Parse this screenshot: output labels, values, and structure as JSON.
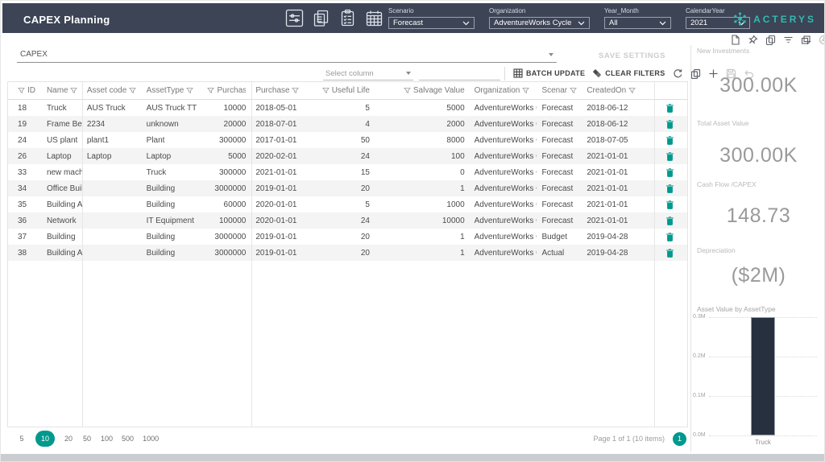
{
  "header": {
    "title": "CAPEX Planning",
    "toolbar_icons": [
      "sliders-icon",
      "copy-pages-icon",
      "checklist-icon",
      "calendar-icon"
    ],
    "filters": [
      {
        "label": "Scenario",
        "value": "Forecast"
      },
      {
        "label": "Organization",
        "value": "AdventureWorks Cycle"
      },
      {
        "label": "Year_Month",
        "value": "All"
      },
      {
        "label": "CalendarYear",
        "value": "2021"
      }
    ],
    "brand": "ACTERYS"
  },
  "visual_header_icons": [
    "new-page-icon",
    "pin-icon",
    "copy-icon",
    "filter-lines-icon",
    "layers-icon",
    "info-icon"
  ],
  "toolbar": {
    "table_select": "CAPEX",
    "save_settings": "SAVE SETTINGS",
    "select_column_placeholder": "Select column",
    "batch_update": "BATCH UPDATE",
    "clear_filters": "CLEAR FILTERS"
  },
  "table": {
    "columns": [
      "ID",
      "Name",
      "Asset code",
      "AssetType",
      "Purchase Value",
      "Purchase Date",
      "Useful Life",
      "Salvage Value",
      "Organization",
      "Scenario",
      "CreatedOn"
    ],
    "rows": [
      [
        "18",
        "Truck",
        "AUS Truck",
        "AUS Truck TT",
        "10000",
        "2018-05-01",
        "5",
        "5000",
        "AdventureWorks C...",
        "Forecast",
        "2018-06-12"
      ],
      [
        "19",
        "Frame Bend...",
        "2234",
        "unknown",
        "20000",
        "2018-07-01",
        "4",
        "2000",
        "AdventureWorks C...",
        "Forecast",
        "2018-06-12"
      ],
      [
        "24",
        "US plant",
        "plant1",
        "Plant",
        "300000",
        "2017-01-01",
        "50",
        "8000",
        "AdventureWorks C...",
        "Forecast",
        "2018-07-05"
      ],
      [
        "26",
        "Laptop",
        "Laptop",
        "Laptop",
        "5000",
        "2020-02-01",
        "24",
        "100",
        "AdventureWorks C...",
        "Forecast",
        "2021-01-01"
      ],
      [
        "33",
        "new machine",
        "",
        "Truck",
        "300000",
        "2021-01-01",
        "15",
        "0",
        "AdventureWorks C...",
        "Forecast",
        "2021-01-01"
      ],
      [
        "34",
        "Office Buildi...",
        "",
        "Building",
        "3000000",
        "2019-01-01",
        "20",
        "1",
        "AdventureWorks C...",
        "Forecast",
        "2021-01-01"
      ],
      [
        "35",
        "Building A",
        "",
        "Building",
        "60000",
        "2020-01-01",
        "5",
        "1000",
        "AdventureWorks C...",
        "Forecast",
        "2021-01-01"
      ],
      [
        "36",
        "Network",
        "",
        "IT Equipment",
        "100000",
        "2020-01-01",
        "24",
        "10000",
        "AdventureWorks C...",
        "Forecast",
        "2021-01-01"
      ],
      [
        "37",
        "Building",
        "",
        "Building",
        "3000000",
        "2019-01-01",
        "20",
        "1",
        "AdventureWorks C...",
        "Budget",
        "2019-04-28"
      ],
      [
        "38",
        "Building Act...",
        "",
        "Building",
        "3000000",
        "2019-01-01",
        "20",
        "1",
        "AdventureWorks C...",
        "Actual",
        "2019-04-28"
      ]
    ]
  },
  "pagination": {
    "page_sizes": [
      "5",
      "10",
      "20",
      "50",
      "100",
      "500",
      "1000"
    ],
    "selected_size": "10",
    "info": "Page 1 of 1 (10 items)",
    "current_page": "1"
  },
  "sidebar": {
    "kpis": [
      {
        "label": "New Investments",
        "value": "300.00K"
      },
      {
        "label": "Total Asset Value",
        "value": "300.00K"
      },
      {
        "label": "Cash Flow /CAPEX",
        "value": "148.73"
      },
      {
        "label": "Depreciation",
        "value": "($2M)"
      }
    ]
  },
  "chart_data": {
    "type": "bar",
    "title": "Asset Value by AssetType",
    "categories": [
      "Truck"
    ],
    "values": [
      300000
    ],
    "ylim": [
      0,
      300000
    ],
    "yticks": [
      "0.3M",
      "0.2M",
      "0.1M",
      "0.0M"
    ],
    "grid": true,
    "legend": false,
    "bar_color": "#27303e"
  },
  "colors": {
    "header_bg": "#3c4456",
    "accent_teal": "#00998d",
    "brand_teal": "#35b8b0",
    "bar_fill": "#27303e",
    "alt_row": "#f4f4f4"
  }
}
